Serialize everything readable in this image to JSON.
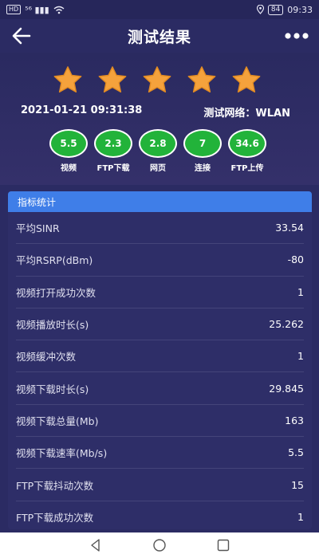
{
  "status_bar": {
    "hd": "HD",
    "signal": "⁵⁶ ▮▮▮",
    "battery": "84",
    "time": "09:33"
  },
  "header": {
    "title": "测试结果"
  },
  "rating": {
    "stars": 5,
    "max": 5
  },
  "test": {
    "datetime": "2021-01-21 09:31:38",
    "network_label": "测试网络：WLAN"
  },
  "metrics": [
    {
      "value": "5.5",
      "label": "视频"
    },
    {
      "value": "2.3",
      "label": "FTP下载"
    },
    {
      "value": "2.8",
      "label": "网页"
    },
    {
      "value": "7",
      "label": "连接"
    },
    {
      "value": "34.6",
      "label": "FTP上传"
    }
  ],
  "stats": {
    "title": "指标统计",
    "rows": [
      {
        "label": "平均SINR",
        "value": "33.54"
      },
      {
        "label": "平均RSRP(dBm)",
        "value": "-80"
      },
      {
        "label": "视频打开成功次数",
        "value": "1"
      },
      {
        "label": "视频播放时长(s)",
        "value": "25.262"
      },
      {
        "label": "视频缓冲次数",
        "value": "1"
      },
      {
        "label": "视频下载时长(s)",
        "value": "29.845"
      },
      {
        "label": "视频下载总量(Mb)",
        "value": "163"
      },
      {
        "label": "视频下载速率(Mb/s)",
        "value": "5.5"
      },
      {
        "label": "FTP下载抖动次数",
        "value": "15"
      },
      {
        "label": "FTP下载成功次数",
        "value": "1"
      }
    ]
  },
  "colors": {
    "background": "#2b2b63",
    "star": "#f5a23c",
    "metric_circle": "#22b33a",
    "stats_header": "#3f7ee8"
  }
}
